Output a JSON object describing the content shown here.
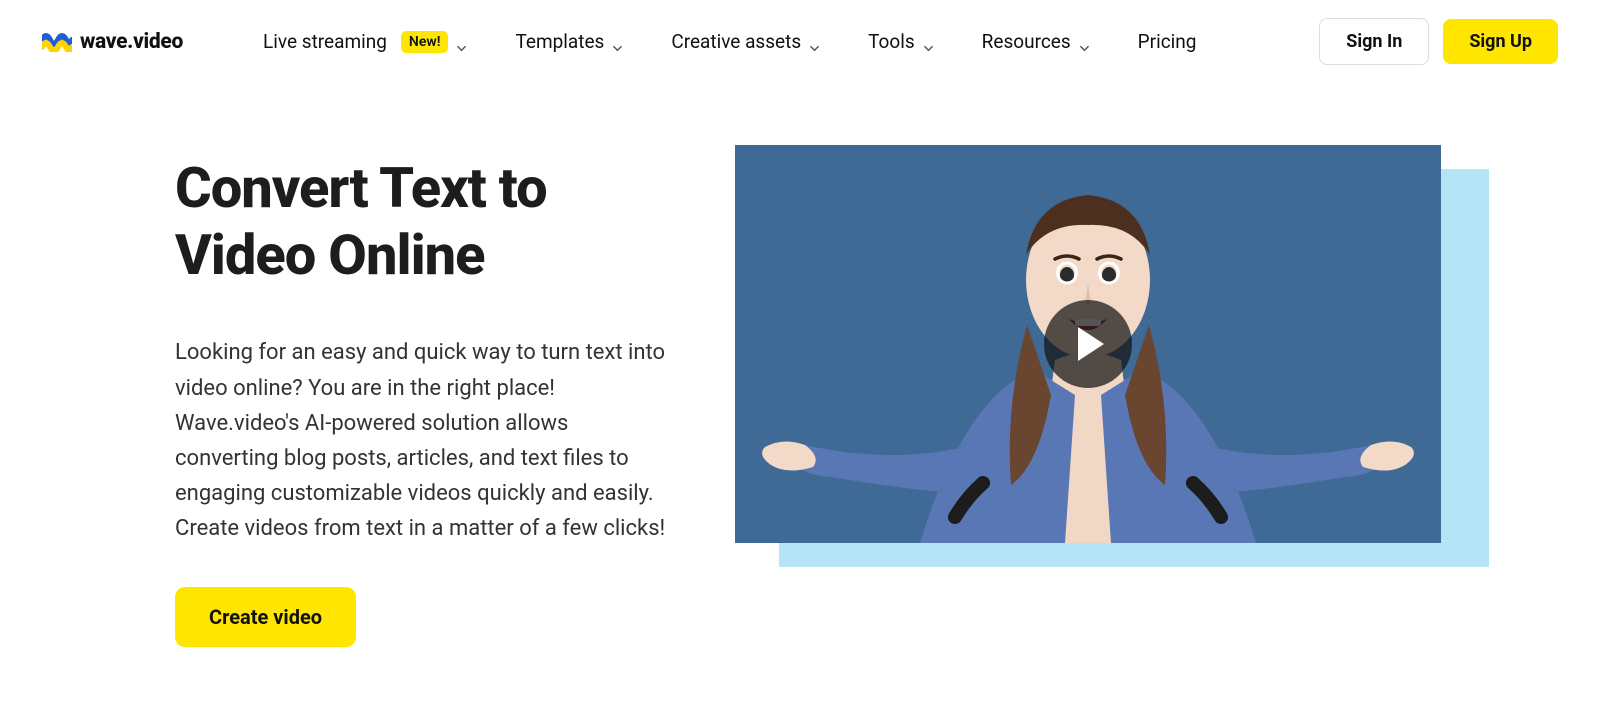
{
  "brand": {
    "name": "wave.video"
  },
  "nav": {
    "items": [
      {
        "label": "Live streaming",
        "badge": "New!",
        "dropdown": true
      },
      {
        "label": "Templates",
        "dropdown": true
      },
      {
        "label": "Creative assets",
        "dropdown": true
      },
      {
        "label": "Tools",
        "dropdown": true
      },
      {
        "label": "Resources",
        "dropdown": true
      },
      {
        "label": "Pricing",
        "dropdown": false
      }
    ],
    "sign_in": "Sign In",
    "sign_up": "Sign Up"
  },
  "hero": {
    "title": "Convert Text to Video Online",
    "description": "Looking for an easy and quick way to turn text into video online? You are in the right place! Wave.video's AI-powered solution allows converting blog posts, articles, and text files to engaging customizable videos quickly and easily. Create videos from text in a matter of a few clicks!",
    "cta": "Create video"
  },
  "colors": {
    "accent_yellow": "#ffe600",
    "video_bg": "#3e6a95",
    "video_strip": "#b6e4f7"
  }
}
